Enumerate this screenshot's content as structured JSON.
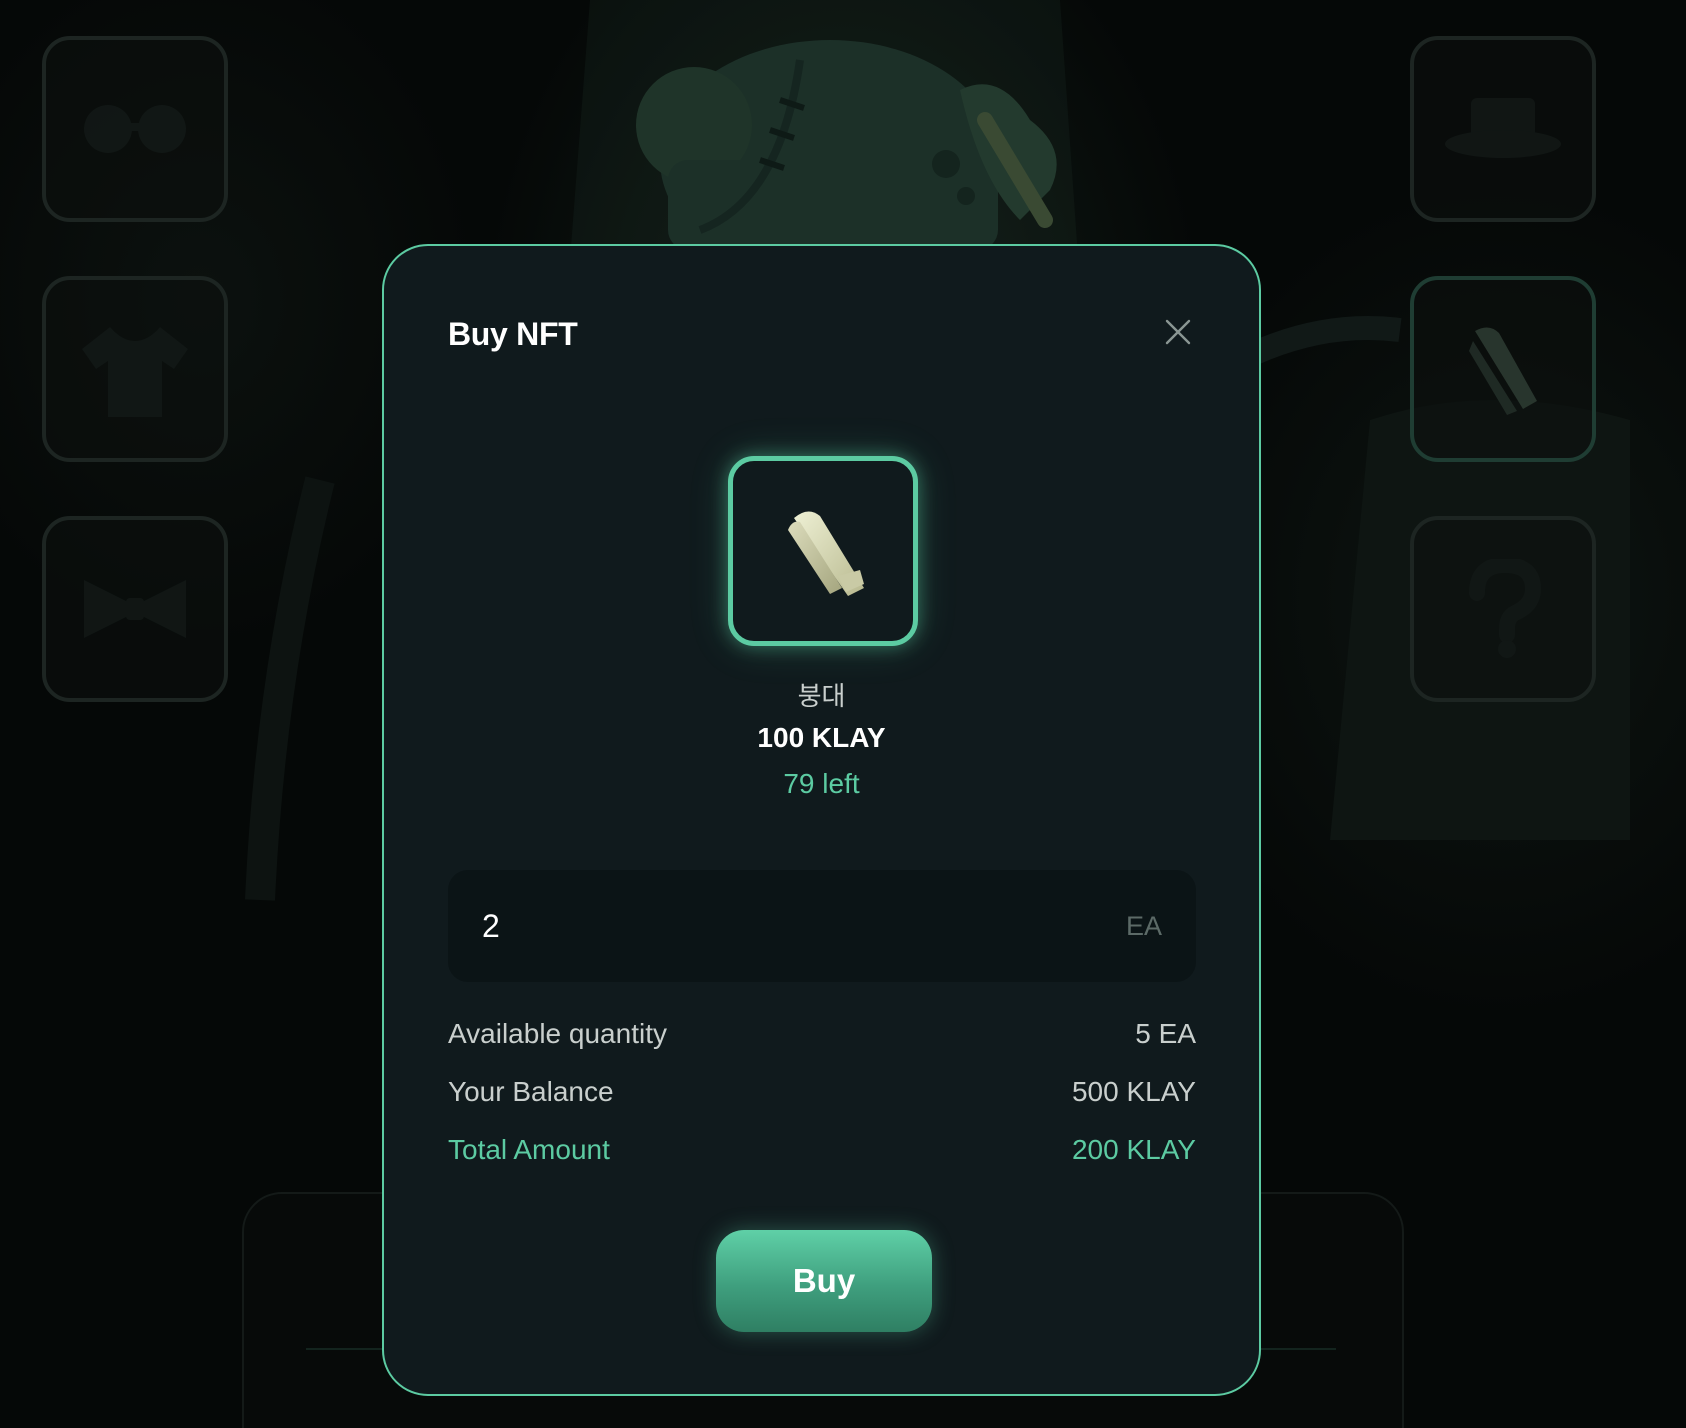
{
  "modal": {
    "title": "Buy NFT",
    "close_icon": "close-icon"
  },
  "item": {
    "icon": "bandage-icon",
    "name": "붕대",
    "price": "100 KLAY",
    "remaining": "79 left"
  },
  "quantity": {
    "value": "2",
    "unit": "EA"
  },
  "summary": {
    "available_label": "Available quantity",
    "available_value": "5 EA",
    "balance_label": "Your Balance",
    "balance_value": "500 KLAY",
    "total_label": "Total Amount",
    "total_value": "200 KLAY"
  },
  "buy_button": {
    "label": "Buy"
  },
  "background": {
    "left_slots": [
      "glasses-icon",
      "tshirt-icon",
      "bowtie-icon"
    ],
    "right_slots": [
      "hat-icon",
      "bandage-icon",
      "question-icon"
    ]
  },
  "colors": {
    "accent": "#5ccba2",
    "modal_bg": "#101a1d",
    "page_bg": "#050807"
  }
}
